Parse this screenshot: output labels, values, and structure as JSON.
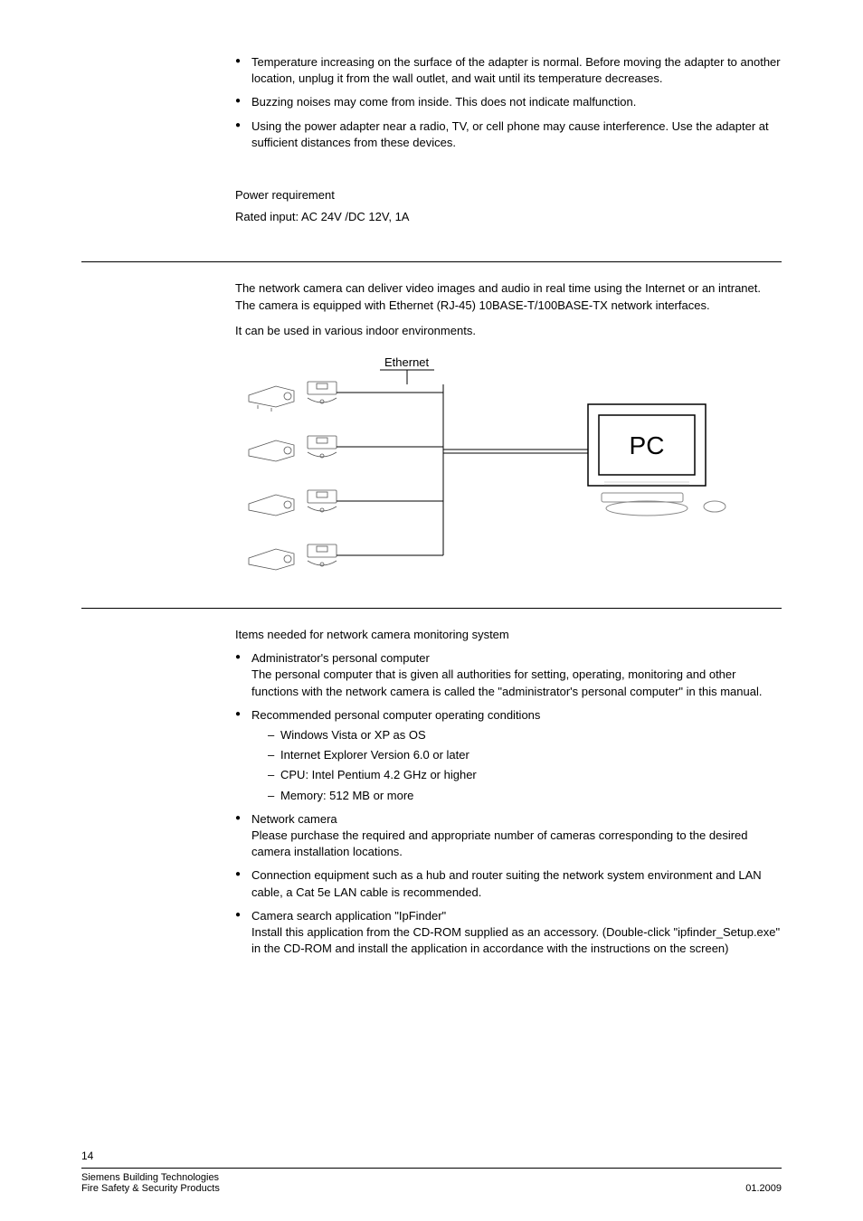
{
  "bullets_top": [
    "Temperature increasing on the surface of the adapter is normal. Before moving the adapter to another location, unplug it from the wall outlet, and wait until its temperature decreases.",
    "Buzzing noises may come from inside. This does not indicate malfunction.",
    "Using the power adapter near a radio, TV, or cell phone may cause interference. Use the adapter at sufficient distances from these devices."
  ],
  "power": {
    "heading": "Power requirement",
    "rated": "Rated input: AC 24V /DC 12V, 1A"
  },
  "network_intro": [
    "The network camera can deliver video images and audio in real time using the Internet or an intranet. The camera is equipped with Ethernet (RJ-45) 10BASE-T/100BASE-TX network interfaces.",
    "It can be used in various indoor environments."
  ],
  "diagram": {
    "ethernet_label": "Ethernet",
    "pc_label": "PC"
  },
  "items_heading": "Items needed for network camera monitoring system",
  "items": [
    {
      "title": "Administrator's personal computer",
      "body": "The personal computer that is given all authorities for setting, operating, monitoring and other functions with the network camera is called the \"administrator's personal computer\" in this manual."
    },
    {
      "title": "Recommended personal computer operating conditions",
      "sub": [
        "Windows Vista or XP as OS",
        "Internet Explorer Version 6.0 or later",
        "CPU: Intel Pentium 4.2 GHz or higher",
        "Memory: 512 MB or more"
      ]
    },
    {
      "title": "Network camera",
      "body": "Please purchase the required and appropriate number of cameras corresponding to the desired camera installation locations."
    },
    {
      "title_only": "Connection equipment such as a hub and router suiting the network system environment and LAN cable, a Cat 5e LAN cable is recommended."
    },
    {
      "title": "Camera search application \"IpFinder\"",
      "body": "Install this application from the CD-ROM supplied as an accessory. (Double-click \"ipfinder_Setup.exe\" in the CD-ROM and install the application in accordance with the instructions on the screen)"
    }
  ],
  "footer": {
    "page_num": "14",
    "left1": "Siemens Building Technologies",
    "left2": "Fire Safety & Security Products",
    "right": "01.2009"
  }
}
